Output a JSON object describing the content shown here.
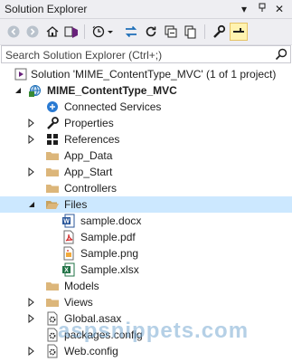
{
  "window": {
    "title": "Solution Explorer"
  },
  "search": {
    "placeholder": "Search Solution Explorer (Ctrl+;)"
  },
  "toolbar": {
    "icons": [
      "back-icon",
      "forward-icon",
      "home-icon",
      "vs-switch-views-icon",
      "pending-changes-filter-icon",
      "dropdown-arrow-icon",
      "sync-icon",
      "refresh-icon",
      "collapse-all-icon",
      "show-all-files-icon",
      "properties-wrench-icon",
      "preview-selected-icon"
    ]
  },
  "tree": {
    "solution": {
      "label": "Solution 'MIME_ContentType_MVC' (1 of 1 project)"
    },
    "project": {
      "label": "MIME_ContentType_MVC"
    },
    "connected_services": "Connected Services",
    "properties": "Properties",
    "references": "References",
    "app_data": "App_Data",
    "app_start": "App_Start",
    "controllers": "Controllers",
    "files": "Files",
    "file_docx": "sample.docx",
    "file_pdf": "Sample.pdf",
    "file_png": "Sample.png",
    "file_xlsx": "Sample.xlsx",
    "models": "Models",
    "views": "Views",
    "global_asax": "Global.asax",
    "packages_config": "packages.config",
    "web_config": "Web.config"
  },
  "watermark": "aspsnippets.com",
  "colors": {
    "selection": "#cce8ff",
    "folder": "#dcb67a",
    "accent": "#1e6fb8"
  }
}
